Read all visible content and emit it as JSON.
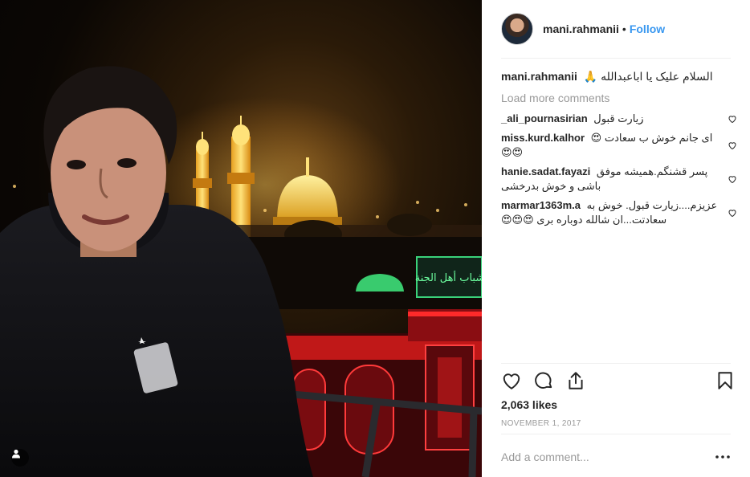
{
  "header": {
    "username": "mani.rahmanii",
    "separator": "•",
    "follow_label": "Follow"
  },
  "caption": {
    "username": "mani.rahmanii",
    "text": "السلام علیک یا اباعبدالله 🙏"
  },
  "load_more_label": "Load more comments",
  "comments": [
    {
      "username": "_ali_pournasirian",
      "text": "زیارت قبول"
    },
    {
      "username": "miss.kurd.kalhor",
      "text": "ای جانم خوش ب سعادت 😍😍😍"
    },
    {
      "username": "hanie.sadat.fayazi",
      "text": "پسر قشنگم.همیشه موفق باشی و خوش بدرخشی"
    },
    {
      "username": "marmar1363m.a",
      "text": "عزیزم....زیارت قبول. خوش به سعادتت...ان شالله دوباره بری 😍😍😍"
    }
  ],
  "likes_text": "2,063 likes",
  "date_text": "NOVEMBER 1, 2017",
  "comment_input": {
    "placeholder": "Add a comment...",
    "value": ""
  },
  "photo": {
    "sign_text": "شباب أهل الجنة"
  },
  "colors": {
    "accent": "#3897f0",
    "muted": "#999999",
    "text": "#262626",
    "border": "#efefef"
  },
  "icons": [
    "heart-icon",
    "comment-icon",
    "share-icon",
    "bookmark-icon",
    "more-icon",
    "user-tag-icon"
  ]
}
